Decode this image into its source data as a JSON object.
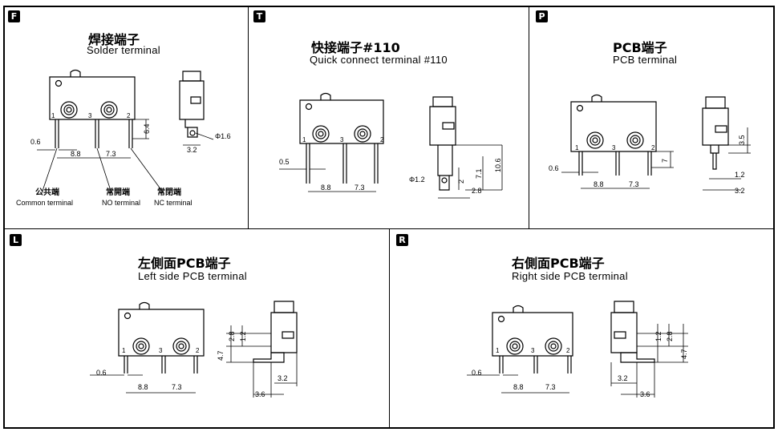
{
  "panels": {
    "F": {
      "badge": "F",
      "title_cn": "焊接端子",
      "title_en": "Solder terminal",
      "dims": {
        "pin_w": "0.6",
        "sp1": "8.8",
        "sp2": "7.3",
        "h": "6.4",
        "dia": "Φ1.6",
        "side_w": "3.2"
      },
      "pins": [
        "1",
        "3",
        "2"
      ],
      "labels": {
        "common_cn": "公共端",
        "common_en": "Common terminal",
        "no_cn": "常開端",
        "no_en": "NO terminal",
        "nc_cn": "常閉端",
        "nc_en": "NC terminal"
      }
    },
    "T": {
      "badge": "T",
      "title_cn": "快接端子#110",
      "title_en": "Quick connect  terminal #110",
      "dims": {
        "pin_w": "0.5",
        "sp1": "8.8",
        "sp2": "7.3",
        "dia": "Φ1.2",
        "h1": "7.1",
        "h2": "10.6",
        "h3": "2",
        "side_w": "2.8"
      },
      "pins": [
        "1",
        "3",
        "2"
      ]
    },
    "P": {
      "badge": "P",
      "title_cn": "PCB端子",
      "title_en": "PCB  terminal",
      "dims": {
        "pin_w": "0.6",
        "sp1": "8.8",
        "sp2": "7.3",
        "h": "7",
        "side_h": "3.5",
        "side_w1": "1.2",
        "side_w2": "3.2"
      },
      "pins": [
        "1",
        "3",
        "2"
      ]
    },
    "L": {
      "badge": "L",
      "title_cn": "左側面PCB端子",
      "title_en": "Left side PCB terminal",
      "dims": {
        "pin_w": "0.6",
        "sp1": "8.8",
        "sp2": "7.3",
        "v1": "4.7",
        "v2": "2.8",
        "v3": "1.2",
        "h1": "3.2",
        "h2": "3.6"
      },
      "pins": [
        "1",
        "3",
        "2"
      ]
    },
    "R": {
      "badge": "R",
      "title_cn": "右側面PCB端子",
      "title_en": "Right  side  PCB  terminal",
      "dims": {
        "pin_w": "0.6",
        "sp1": "8.8",
        "sp2": "7.3",
        "v1": "1.2",
        "v2": "2.8",
        "v3": "4.7",
        "h1": "3.2",
        "h2": "3.6"
      },
      "pins": [
        "1",
        "3",
        "2"
      ]
    }
  }
}
